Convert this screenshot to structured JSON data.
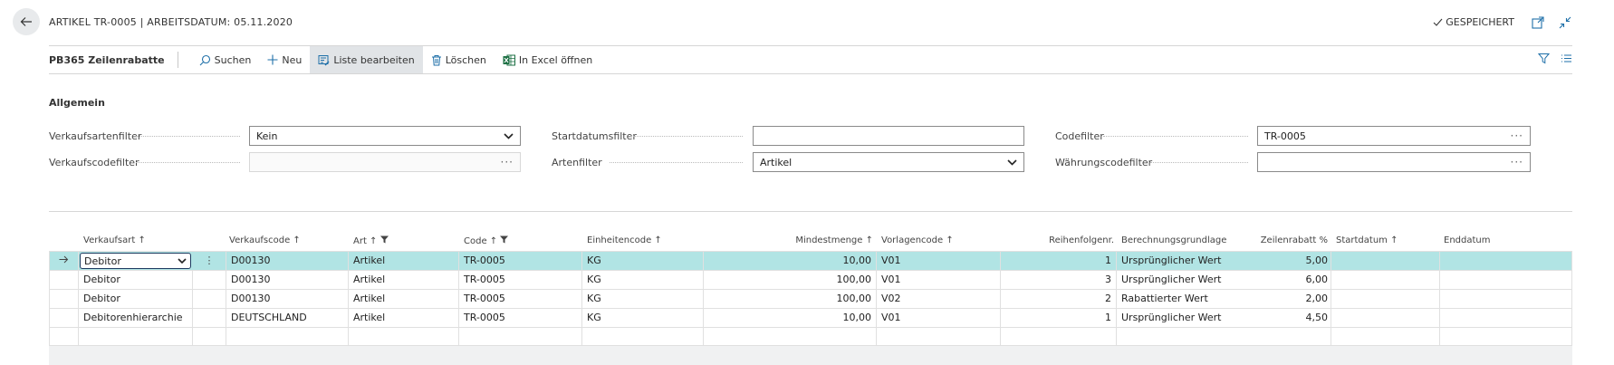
{
  "header": {
    "title": "ARTIKEL TR-0005 | ARBEITSDATUM: 05.11.2020",
    "saved_label": "GESPEICHERT"
  },
  "actions": {
    "page_name": "PB365 Zeilenrabatte",
    "search": "Suchen",
    "new": "Neu",
    "edit_list": "Liste bearbeiten",
    "delete": "Löschen",
    "excel": "In Excel öffnen"
  },
  "filters": {
    "group_title": "Allgemein",
    "sales_type_label": "Verkaufsartenfilter",
    "sales_type_value": "Kein",
    "sales_code_label": "Verkaufscodefilter",
    "sales_code_value": "",
    "start_date_label": "Startdatumsfilter",
    "start_date_value": "",
    "type_label": "Artenfilter",
    "type_value": "Artikel",
    "code_label": "Codefilter",
    "code_value": "TR-0005",
    "currency_label": "Währungscodefilter",
    "currency_value": ""
  },
  "grid": {
    "columns": {
      "sales_type": "Verkaufsart ↑",
      "sales_code": "Verkaufscode ↑",
      "type": "Art ↑",
      "code": "Code ↑",
      "unit": "Einheitencode ↑",
      "min_qty": "Mindestmenge ↑",
      "template": "Vorlagencode ↑",
      "seq": "Reihenfolgenr.",
      "basis": "Berechnungsgrundlage",
      "discount": "Zeilenrabatt %",
      "start": "Startdatum ↑",
      "end": "Enddatum"
    },
    "rows": [
      {
        "sales_type": "Debitor",
        "sales_code": "D00130",
        "type": "Artikel",
        "code": "TR-0005",
        "unit": "KG",
        "min_qty": "10,00",
        "template": "V01",
        "seq": "1",
        "basis": "Ursprünglicher Wert",
        "discount": "5,00",
        "start": "",
        "end": ""
      },
      {
        "sales_type": "Debitor",
        "sales_code": "D00130",
        "type": "Artikel",
        "code": "TR-0005",
        "unit": "KG",
        "min_qty": "100,00",
        "template": "V01",
        "seq": "3",
        "basis": "Ursprünglicher Wert",
        "discount": "6,00",
        "start": "",
        "end": ""
      },
      {
        "sales_type": "Debitor",
        "sales_code": "D00130",
        "type": "Artikel",
        "code": "TR-0005",
        "unit": "KG",
        "min_qty": "100,00",
        "template": "V02",
        "seq": "2",
        "basis": "Rabattierter Wert",
        "discount": "2,00",
        "start": "",
        "end": ""
      },
      {
        "sales_type": "Debitorenhierarchie",
        "sales_code": "DEUTSCHLAND",
        "type": "Artikel",
        "code": "TR-0005",
        "unit": "KG",
        "min_qty": "10,00",
        "template": "V01",
        "seq": "1",
        "basis": "Ursprünglicher Wert",
        "discount": "4,50",
        "start": "",
        "end": ""
      },
      {
        "sales_type": "",
        "sales_code": "",
        "type": "",
        "code": "",
        "unit": "",
        "min_qty": "",
        "template": "",
        "seq": "",
        "basis": "",
        "discount": "",
        "start": "",
        "end": ""
      }
    ]
  },
  "colors": {
    "selected_row": "#b1e4e4",
    "accent": "#1e6fa8",
    "excel_green": "#1d7044"
  }
}
